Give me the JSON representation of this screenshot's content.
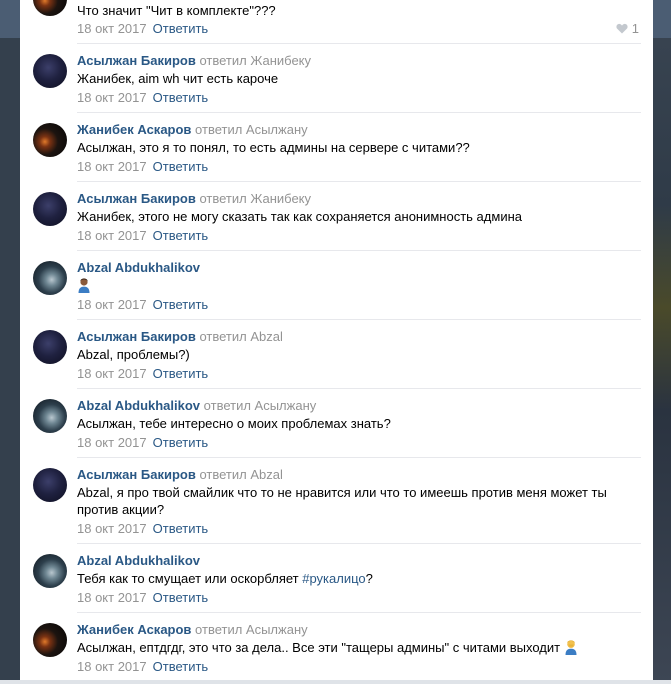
{
  "comments": [
    {
      "text": "Что значит \"Чит в комплекте\"???",
      "date": "18 окт 2017",
      "reply": "Ответить",
      "likes": "1"
    },
    {
      "author": "Асылжан Бакиров",
      "replied": "ответил Жанибеку",
      "text": "Жанибек, aim wh чит есть кароче",
      "date": "18 окт 2017",
      "reply": "Ответить"
    },
    {
      "author": "Жанибек Аскаров",
      "replied": "ответил Асылжану",
      "text": "Асылжан, это я то понял, то есть админы на сервере с читами??",
      "date": "18 окт 2017",
      "reply": "Ответить"
    },
    {
      "author": "Асылжан Бакиров",
      "replied": "ответил Жанибеку",
      "text": "Жанибек, этого не могу сказать так как сохраняется анонимность админа",
      "date": "18 окт 2017",
      "reply": "Ответить"
    },
    {
      "author": "Abzal Abdukhalikov",
      "replied": "",
      "emoji": "person-emoji",
      "date": "18 окт 2017",
      "reply": "Ответить"
    },
    {
      "author": "Асылжан Бакиров",
      "replied": "ответил Abzal",
      "text": "Abzal, проблемы?)",
      "date": "18 окт 2017",
      "reply": "Ответить"
    },
    {
      "author": "Abzal Abdukhalikov",
      "replied": "ответил Асылжану",
      "text": "Асылжан, тебе интересно о моих проблемах знать?",
      "date": "18 окт 2017",
      "reply": "Ответить"
    },
    {
      "author": "Асылжан Бакиров",
      "replied": "ответил Abzal",
      "text": "Abzal, я про твой смайлик что то не нравится или что то имеешь против меня может ты против акции?",
      "date": "18 окт 2017",
      "reply": "Ответить"
    },
    {
      "author": "Abzal Abdukhalikov",
      "replied": "",
      "text_before": "Тебя как то смущает или оскорбляет ",
      "hashtag": "#рукалицо",
      "text_after": "?",
      "date": "18 окт 2017",
      "reply": "Ответить"
    },
    {
      "author": "Жанибек Аскаров",
      "replied": "ответил Асылжану",
      "text": "Асылжан, ептдгдг, это что за дела.. Все эти \"тащеры админы\" с читами выходит",
      "emoji": "facepalm-emoji",
      "date": "18 окт 2017",
      "reply": "Ответить"
    }
  ],
  "colors": {
    "link": "#2a5885",
    "muted": "#939393",
    "separator": "#e7e8ec"
  }
}
